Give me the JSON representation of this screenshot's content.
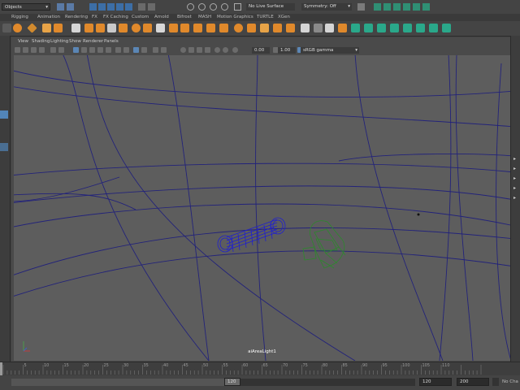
{
  "status_line": {
    "mode_menu": "Objects",
    "live_surface": "No Live Surface",
    "symmetry": "Symmetry: Off"
  },
  "shelf_tabs": [
    "Rigging",
    "Animation",
    "Rendering",
    "FX",
    "FX Caching",
    "Custom",
    "Arnold",
    "Bifrost",
    "MASH",
    "Motion Graphics",
    "TURTLE",
    "XGen"
  ],
  "panel_menu": [
    "View",
    "Shading",
    "Lighting",
    "Show",
    "Renderer",
    "Panels"
  ],
  "panel_toolbar": {
    "exposure": "0.00",
    "gamma": "1.00",
    "color_space": "sRGB gamma"
  },
  "viewport": {
    "camera_label": "aiAreaLight1"
  },
  "time_slider": {
    "ticks": [
      "5",
      "10",
      "15",
      "20",
      "25",
      "30",
      "35",
      "40",
      "45",
      "50",
      "55",
      "60",
      "65",
      "70",
      "75",
      "80",
      "85",
      "90",
      "95",
      "100",
      "105",
      "110"
    ]
  },
  "range_slider": {
    "range_end_field": "120",
    "anim_end": "120",
    "max_time": "200",
    "character_set": "No Cha"
  },
  "colors": {
    "viewport_bg": "#5d5d5d",
    "curve": "#23237a",
    "selected_wire": "#1f1fd0",
    "light_wire": "#2b8a2b",
    "shelf_icon_orange": "#e0892b",
    "shelf_icon_teal": "#2aa88a"
  }
}
